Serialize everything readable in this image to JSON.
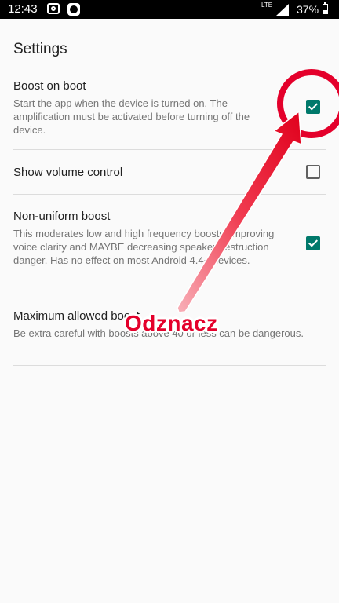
{
  "status_bar": {
    "time": "12:43",
    "network": "LTE",
    "battery": "37%",
    "icons": [
      "screenshot-icon",
      "app-notification-icon",
      "signal-icon",
      "battery-icon"
    ]
  },
  "screen": {
    "title": "Settings"
  },
  "preferences": [
    {
      "title": "Boost on boot",
      "summary": "Start the app when the device is turned on. The amplification must be activated before turning off the device.",
      "checked": true
    },
    {
      "title": "Show volume control",
      "summary": "",
      "checked": false
    },
    {
      "title": "Non-uniform boost",
      "summary": "This moderates low and high frequency boosts, improving voice clarity and MAYBE decreasing speaker destruction danger. Has no effect on most Android 4.4+ devices.",
      "checked": true
    },
    {
      "title": "Maximum allowed boost",
      "summary": "Be extra careful with boosts above 40 or less can be dangerous."
    }
  ],
  "annotation": {
    "label": "Odznacz",
    "color": "#e4002b"
  },
  "colors": {
    "accent": "#00796b",
    "background": "#fafafa"
  }
}
